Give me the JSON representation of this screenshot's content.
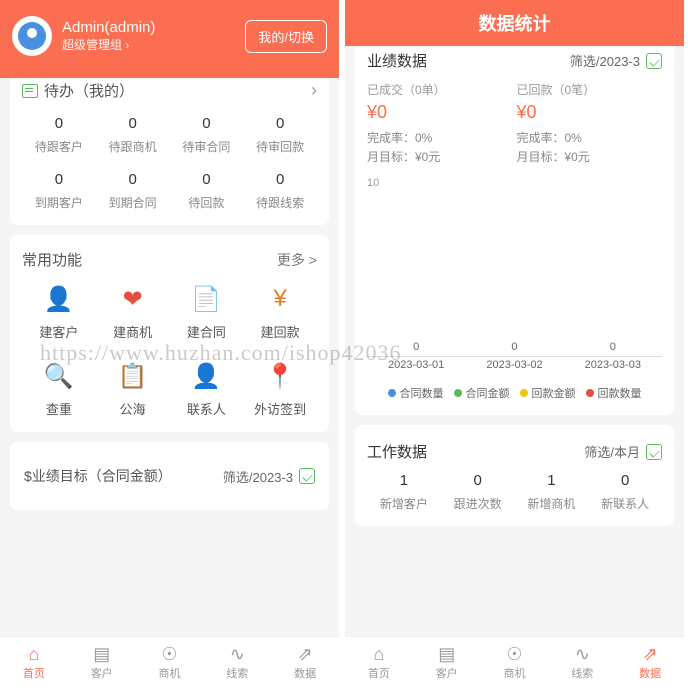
{
  "watermark": "https://www.huzhan.com/ishop42036",
  "left": {
    "user": {
      "name": "Admin(admin)",
      "role": "超级管理组 ›"
    },
    "switch_btn": "我的/切换",
    "todo": {
      "title": "待办（我的）",
      "items": [
        {
          "val": "0",
          "lab": "待跟客户"
        },
        {
          "val": "0",
          "lab": "待跟商机"
        },
        {
          "val": "0",
          "lab": "待审合同"
        },
        {
          "val": "0",
          "lab": "待审回款"
        },
        {
          "val": "0",
          "lab": "到期客户"
        },
        {
          "val": "0",
          "lab": "到期合同"
        },
        {
          "val": "0",
          "lab": "待回款"
        },
        {
          "val": "0",
          "lab": "待跟线索"
        }
      ]
    },
    "funcs": {
      "title": "常用功能",
      "more": "更多 >",
      "items": [
        {
          "lab": "建客户",
          "color": "#4a90e2",
          "glyph": "👤"
        },
        {
          "lab": "建商机",
          "color": "#e74c3c",
          "glyph": "❤"
        },
        {
          "lab": "建合同",
          "color": "#e67e22",
          "glyph": "📄"
        },
        {
          "lab": "建回款",
          "color": "#e67e22",
          "glyph": "¥"
        },
        {
          "lab": "查重",
          "color": "#4a90e2",
          "glyph": "🔍"
        },
        {
          "lab": "公海",
          "color": "#4a90e2",
          "glyph": "📋"
        },
        {
          "lab": "联系人",
          "color": "#5cb85c",
          "glyph": "👤"
        },
        {
          "lab": "外访签到",
          "color": "#f39c12",
          "glyph": "📍"
        }
      ]
    },
    "target": {
      "label": "$业绩目标（合同金额）",
      "filter": "筛选/2023-3"
    }
  },
  "right": {
    "title": "数据统计",
    "perf": {
      "title": "业绩数据",
      "filter": "筛选/2023-3",
      "deal": {
        "sub": "已成交（0单）",
        "amt": "¥0",
        "rate": "完成率：0%",
        "goal": "月目标：¥0元"
      },
      "back": {
        "sub": "已回款（0笔）",
        "amt": "¥0",
        "rate": "完成率：0%",
        "goal": "月目标：¥0元"
      },
      "legend": [
        "合同数量",
        "合同金额",
        "回款金额",
        "回款数量"
      ],
      "legend_colors": [
        "#4a90e2",
        "#5cb85c",
        "#f1c40f",
        "#e74c3c"
      ]
    },
    "work": {
      "title": "工作数据",
      "filter": "筛选/本月",
      "items": [
        {
          "val": "1",
          "lab": "新增客户"
        },
        {
          "val": "0",
          "lab": "跟进次数"
        },
        {
          "val": "1",
          "lab": "新增商机"
        },
        {
          "val": "0",
          "lab": "新联系人"
        }
      ]
    }
  },
  "tabs": [
    {
      "lab": "首页",
      "ico": "⌂"
    },
    {
      "lab": "客户",
      "ico": "▤"
    },
    {
      "lab": "商机",
      "ico": "☉"
    },
    {
      "lab": "线索",
      "ico": "∿"
    },
    {
      "lab": "数据",
      "ico": "⇗"
    }
  ],
  "chart_data": {
    "type": "line",
    "title": "",
    "xlabel": "",
    "ylabel": "",
    "categories": [
      "2023-03-01",
      "2023-03-02",
      "2023-03-03"
    ],
    "ylim": [
      0,
      10
    ],
    "series": [
      {
        "name": "合同数量",
        "values": [
          0,
          0,
          0
        ]
      },
      {
        "name": "合同金额",
        "values": [
          0,
          0,
          0
        ]
      },
      {
        "name": "回款金额",
        "values": [
          0,
          0,
          0
        ]
      },
      {
        "name": "回款数量",
        "values": [
          0,
          0,
          0
        ]
      }
    ]
  }
}
